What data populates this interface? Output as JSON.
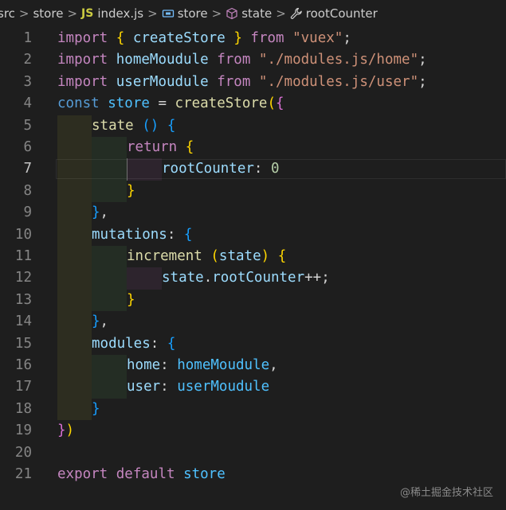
{
  "breadcrumb": {
    "items": [
      {
        "label": "src",
        "icon": ""
      },
      {
        "label": "store",
        "icon": ""
      },
      {
        "label": "index.js",
        "icon": "javascript-file-icon",
        "icon_text": "JS"
      },
      {
        "label": "store",
        "icon": "variable-icon"
      },
      {
        "label": "state",
        "icon": "property-icon"
      },
      {
        "label": "rootCounter",
        "icon": "wrench-icon"
      }
    ],
    "separator": ">"
  },
  "editor": {
    "active_line": 7,
    "colors": {
      "background": "#1e1e1e",
      "keyword_import": "#c586c0",
      "keyword_storage": "#569cd6",
      "string": "#ce9178",
      "function": "#dcdcaa",
      "variable": "#9cdcfe",
      "constant": "#4fc1ff",
      "number": "#b5cea8",
      "bracket_level1": "#ffd700",
      "bracket_level2": "#da70d6",
      "bracket_level3": "#179fff"
    },
    "lines": [
      {
        "number": "1",
        "indent": 0,
        "tokens": [
          [
            "import",
            "kw"
          ],
          [
            " ",
            "p"
          ],
          [
            "{",
            "b1"
          ],
          [
            " ",
            "p"
          ],
          [
            "createStore",
            "var"
          ],
          [
            " ",
            "p"
          ],
          [
            "}",
            "b1"
          ],
          [
            " ",
            "p"
          ],
          [
            "from",
            "kw"
          ],
          [
            " ",
            "p"
          ],
          [
            "\"vuex\"",
            "str"
          ],
          [
            ";",
            "p"
          ]
        ]
      },
      {
        "number": "2",
        "indent": 0,
        "tokens": [
          [
            "import",
            "kw"
          ],
          [
            " ",
            "p"
          ],
          [
            "homeMoudule",
            "var"
          ],
          [
            " ",
            "p"
          ],
          [
            "from",
            "kw"
          ],
          [
            " ",
            "p"
          ],
          [
            "\"./modules.js/home\"",
            "str"
          ],
          [
            ";",
            "p"
          ]
        ]
      },
      {
        "number": "3",
        "indent": 0,
        "tokens": [
          [
            "import",
            "kw"
          ],
          [
            " ",
            "p"
          ],
          [
            "userMoudule",
            "var"
          ],
          [
            " ",
            "p"
          ],
          [
            "from",
            "kw"
          ],
          [
            " ",
            "p"
          ],
          [
            "\"./modules.js/user\"",
            "str"
          ],
          [
            ";",
            "p"
          ]
        ]
      },
      {
        "number": "4",
        "indent": 0,
        "tokens": [
          [
            "const",
            "st"
          ],
          [
            " ",
            "p"
          ],
          [
            "store",
            "cv"
          ],
          [
            " = ",
            "p"
          ],
          [
            "createStore",
            "fn"
          ],
          [
            "(",
            "b1"
          ],
          [
            "{",
            "b2"
          ]
        ]
      },
      {
        "number": "5",
        "indent": 1,
        "tokens": [
          [
            "state",
            "fn"
          ],
          [
            " ",
            "p"
          ],
          [
            "()",
            "b3"
          ],
          [
            " ",
            "p"
          ],
          [
            "{",
            "b3"
          ]
        ]
      },
      {
        "number": "6",
        "indent": 2,
        "tokens": [
          [
            "return",
            "kw"
          ],
          [
            " ",
            "p"
          ],
          [
            "{",
            "b1"
          ]
        ]
      },
      {
        "number": "7",
        "indent": 3,
        "tokens": [
          [
            "rootCounter",
            "var"
          ],
          [
            ": ",
            "p"
          ],
          [
            "0",
            "num"
          ]
        ]
      },
      {
        "number": "8",
        "indent": 2,
        "tokens": [
          [
            "}",
            "b1"
          ]
        ]
      },
      {
        "number": "9",
        "indent": 1,
        "tokens": [
          [
            "}",
            "b3"
          ],
          [
            ",",
            "p"
          ]
        ]
      },
      {
        "number": "10",
        "indent": 1,
        "tokens": [
          [
            "mutations",
            "var"
          ],
          [
            ": ",
            "p"
          ],
          [
            "{",
            "b3"
          ]
        ]
      },
      {
        "number": "11",
        "indent": 2,
        "tokens": [
          [
            "increment",
            "fn"
          ],
          [
            " ",
            "p"
          ],
          [
            "(",
            "b1"
          ],
          [
            "state",
            "var"
          ],
          [
            ")",
            "b1"
          ],
          [
            " ",
            "p"
          ],
          [
            "{",
            "b1"
          ]
        ]
      },
      {
        "number": "12",
        "indent": 3,
        "tokens": [
          [
            "state",
            "var"
          ],
          [
            ".",
            "p"
          ],
          [
            "rootCounter",
            "var"
          ],
          [
            "++;",
            "p"
          ]
        ]
      },
      {
        "number": "13",
        "indent": 2,
        "tokens": [
          [
            "}",
            "b1"
          ]
        ]
      },
      {
        "number": "14",
        "indent": 1,
        "tokens": [
          [
            "}",
            "b3"
          ],
          [
            ",",
            "p"
          ]
        ]
      },
      {
        "number": "15",
        "indent": 1,
        "tokens": [
          [
            "modules",
            "var"
          ],
          [
            ": ",
            "p"
          ],
          [
            "{",
            "b3"
          ]
        ]
      },
      {
        "number": "16",
        "indent": 2,
        "tokens": [
          [
            "home",
            "var"
          ],
          [
            ": ",
            "p"
          ],
          [
            "homeMoudule",
            "cv"
          ],
          [
            ",",
            "p"
          ]
        ]
      },
      {
        "number": "17",
        "indent": 2,
        "tokens": [
          [
            "user",
            "var"
          ],
          [
            ": ",
            "p"
          ],
          [
            "userMoudule",
            "cv"
          ]
        ]
      },
      {
        "number": "18",
        "indent": 1,
        "tokens": [
          [
            "}",
            "b3"
          ]
        ]
      },
      {
        "number": "19",
        "indent": 0,
        "tokens": [
          [
            "}",
            "b2"
          ],
          [
            ")",
            "b1"
          ]
        ]
      },
      {
        "number": "20",
        "indent": 0,
        "tokens": []
      },
      {
        "number": "21",
        "indent": 0,
        "tokens": [
          [
            "export",
            "kw"
          ],
          [
            " ",
            "p"
          ],
          [
            "default",
            "kw"
          ],
          [
            " ",
            "p"
          ],
          [
            "store",
            "cv"
          ]
        ]
      }
    ]
  },
  "watermark": "@稀土掘金技术社区"
}
